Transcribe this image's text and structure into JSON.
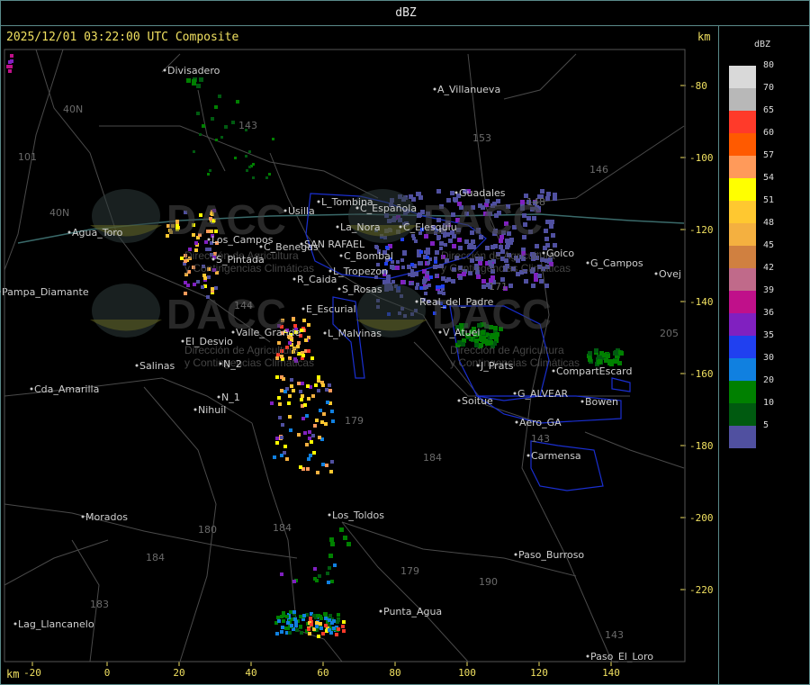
{
  "header": {
    "title": "dBZ",
    "timestamp": "2025/12/01 03:22:00 UTC Composite",
    "km_top": "km",
    "km_bottom": "km"
  },
  "axes": {
    "x_ticks": [
      "-20",
      "0",
      "20",
      "40",
      "60",
      "80",
      "100",
      "120",
      "140"
    ],
    "y_ticks": [
      "-80",
      "-100",
      "-120",
      "-140",
      "-160",
      "-180",
      "-200",
      "-220"
    ]
  },
  "legend": {
    "title": "dBZ",
    "items": [
      {
        "label": "80",
        "color": "#d9d9d9"
      },
      {
        "label": "70",
        "color": "#b8b8b8"
      },
      {
        "label": "65",
        "color": "#ff3a2a"
      },
      {
        "label": "60",
        "color": "#ff5a00"
      },
      {
        "label": "57",
        "color": "#ff9a5a"
      },
      {
        "label": "54",
        "color": "#ffff00"
      },
      {
        "label": "51",
        "color": "#ffc830"
      },
      {
        "label": "48",
        "color": "#f4b040"
      },
      {
        "label": "45",
        "color": "#d08040"
      },
      {
        "label": "42",
        "color": "#c06a8a"
      },
      {
        "label": "39",
        "color": "#c0108a"
      },
      {
        "label": "36",
        "color": "#8020c0"
      },
      {
        "label": "35",
        "color": "#2040f0"
      },
      {
        "label": "30",
        "color": "#1080e0"
      },
      {
        "label": "20",
        "color": "#008000"
      },
      {
        "label": "10",
        "color": "#005a10"
      },
      {
        "label": "5",
        "color": "#5050a0"
      }
    ]
  },
  "places": [
    {
      "name": "Divisadero"
    },
    {
      "name": "A_Villanueva"
    },
    {
      "name": "Guadales"
    },
    {
      "name": "Usilla"
    },
    {
      "name": "L_Tombina"
    },
    {
      "name": "C_Española"
    },
    {
      "name": "La_Nora"
    },
    {
      "name": "C_Elesquiu"
    },
    {
      "name": "C_Benegas"
    },
    {
      "name": "SAN RAFAEL"
    },
    {
      "name": "C_Bombal"
    },
    {
      "name": "L_Tropezon"
    },
    {
      "name": "R_Caida"
    },
    {
      "name": "S_Rosas"
    },
    {
      "name": "Goico"
    },
    {
      "name": "G_Campos"
    },
    {
      "name": "Agua_Toro"
    },
    {
      "name": "Pampa_Diamante"
    },
    {
      "name": "Los_Campos"
    },
    {
      "name": "S_Pintada"
    },
    {
      "name": "E_Escurial"
    },
    {
      "name": "Valle_Grande"
    },
    {
      "name": "L_Malvinas"
    },
    {
      "name": "El_Desvio"
    },
    {
      "name": "Salinas"
    },
    {
      "name": "Cda_Amarilla"
    },
    {
      "name": "N_1"
    },
    {
      "name": "N_2"
    },
    {
      "name": "Nihuil"
    },
    {
      "name": "V_Atuel"
    },
    {
      "name": "J_Prats"
    },
    {
      "name": "CompartEscard"
    },
    {
      "name": "G_ALVEAR"
    },
    {
      "name": "Soitue"
    },
    {
      "name": "Bowen"
    },
    {
      "name": "Aero_GA"
    },
    {
      "name": "Carmensa"
    },
    {
      "name": "Los_Toldos"
    },
    {
      "name": "Morados"
    },
    {
      "name": "Paso_Burroso"
    },
    {
      "name": "Punta_Agua"
    },
    {
      "name": "Lag_Llancanelo"
    },
    {
      "name": "Paso_El_Loro"
    },
    {
      "name": "Ovej"
    },
    {
      "name": "Real_del_Padre"
    }
  ],
  "routes": [
    "40N",
    "40N",
    "101",
    "143",
    "153",
    "146",
    "148",
    "171",
    "144",
    "179",
    "184",
    "184",
    "180",
    "184",
    "183",
    "190",
    "179",
    "143",
    "205",
    "143"
  ],
  "watermark": {
    "text": "DACC",
    "sub1": "Dirección de Agricultura",
    "sub2": "y Contingencias Climáticas"
  },
  "colors": {
    "frame": "#5a8a8a",
    "label_yellow": "#f0e060",
    "roads": "#4a4a4a",
    "boundary": "#1a2fd0"
  }
}
